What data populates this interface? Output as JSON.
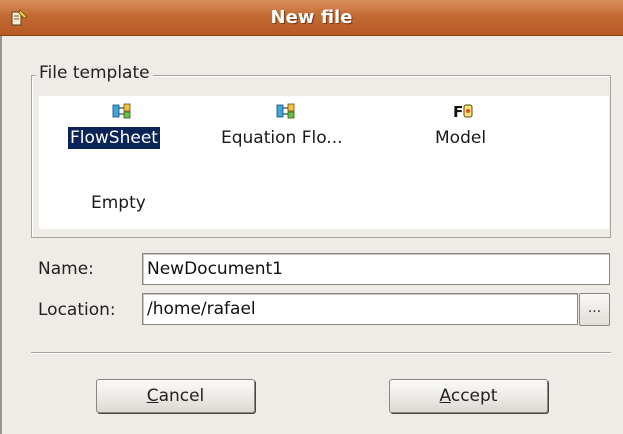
{
  "window": {
    "title": "New file"
  },
  "file_template": {
    "legend": "File template",
    "items": [
      {
        "label": "FlowSheet",
        "icon": "flowsheet-icon",
        "selected": true
      },
      {
        "label": "Equation Flo...",
        "icon": "equation-flowsheet-icon",
        "selected": false
      },
      {
        "label": "Model",
        "icon": "model-icon",
        "selected": false
      },
      {
        "label": "Empty",
        "icon": "",
        "selected": false
      }
    ]
  },
  "form": {
    "name_label": "Name:",
    "name_value": "NewDocument1",
    "location_label": "Location:",
    "location_value": "/home/rafael",
    "browse_label": "..."
  },
  "buttons": {
    "cancel_mnemonic": "C",
    "cancel_rest": "ancel",
    "accept_mnemonic": "A",
    "accept_rest": "ccept"
  },
  "colors": {
    "titlebar": "#c46a33",
    "selection": "#0a2457",
    "window_bg": "#efebe7"
  }
}
